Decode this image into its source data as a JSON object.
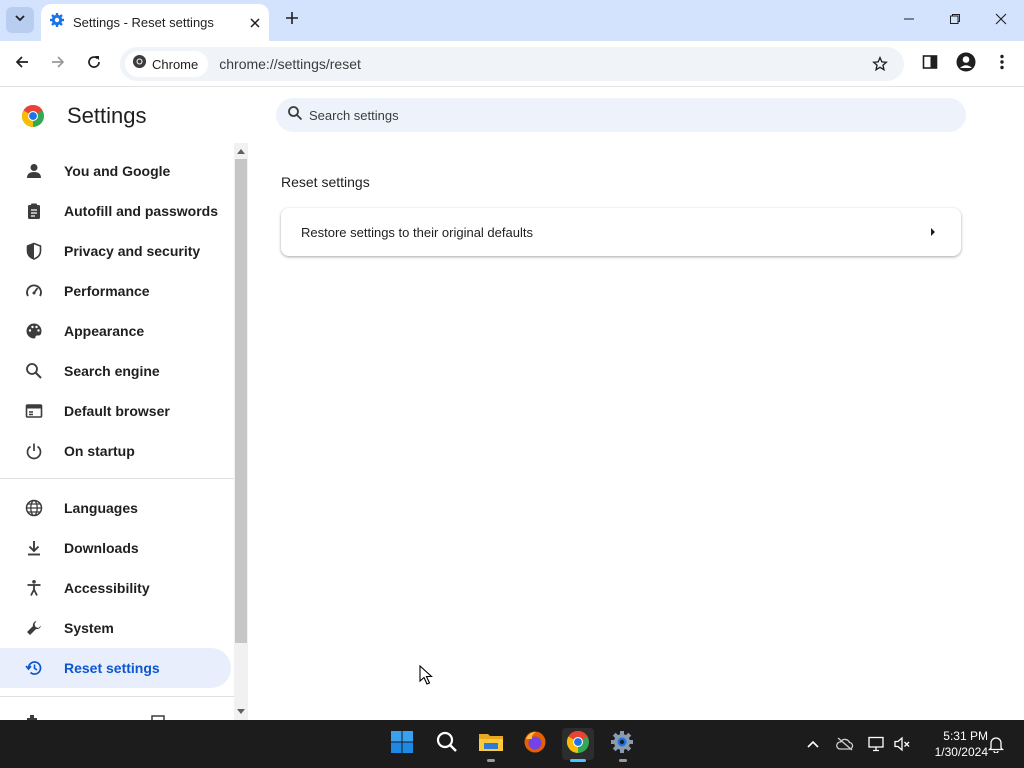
{
  "window": {
    "tab_title": "Settings - Reset settings",
    "new_tab_icon": "plus-icon"
  },
  "toolbar": {
    "chip_label": "Chrome",
    "url": "chrome://settings/reset"
  },
  "settings": {
    "title": "Settings",
    "search_placeholder": "Search settings",
    "nav": [
      {
        "label": "You and Google",
        "icon": "person-icon",
        "active": false
      },
      {
        "label": "Autofill and passwords",
        "icon": "clipboard-icon",
        "active": false
      },
      {
        "label": "Privacy and security",
        "icon": "shield-icon",
        "active": false
      },
      {
        "label": "Performance",
        "icon": "gauge-icon",
        "active": false
      },
      {
        "label": "Appearance",
        "icon": "palette-icon",
        "active": false
      },
      {
        "label": "Search engine",
        "icon": "search-icon",
        "active": false
      },
      {
        "label": "Default browser",
        "icon": "browser-icon",
        "active": false
      },
      {
        "label": "On startup",
        "icon": "power-icon",
        "active": false
      },
      {
        "label": "Languages",
        "icon": "globe-icon",
        "active": false
      },
      {
        "label": "Downloads",
        "icon": "download-icon",
        "active": false
      },
      {
        "label": "Accessibility",
        "icon": "accessibility-icon",
        "active": false
      },
      {
        "label": "System",
        "icon": "wrench-icon",
        "active": false
      },
      {
        "label": "Reset settings",
        "icon": "reset-history-icon",
        "active": true
      }
    ],
    "section_title": "Reset settings",
    "card_label": "Restore settings to their original defaults"
  },
  "taskbar": {
    "time": "5:31 PM",
    "date": "1/30/2024"
  },
  "colors": {
    "tab_strip": "#d3e3fd",
    "accent": "#0b57d0",
    "active_nav_bg": "#e8eefb",
    "taskbar": "#1c1c1c"
  }
}
